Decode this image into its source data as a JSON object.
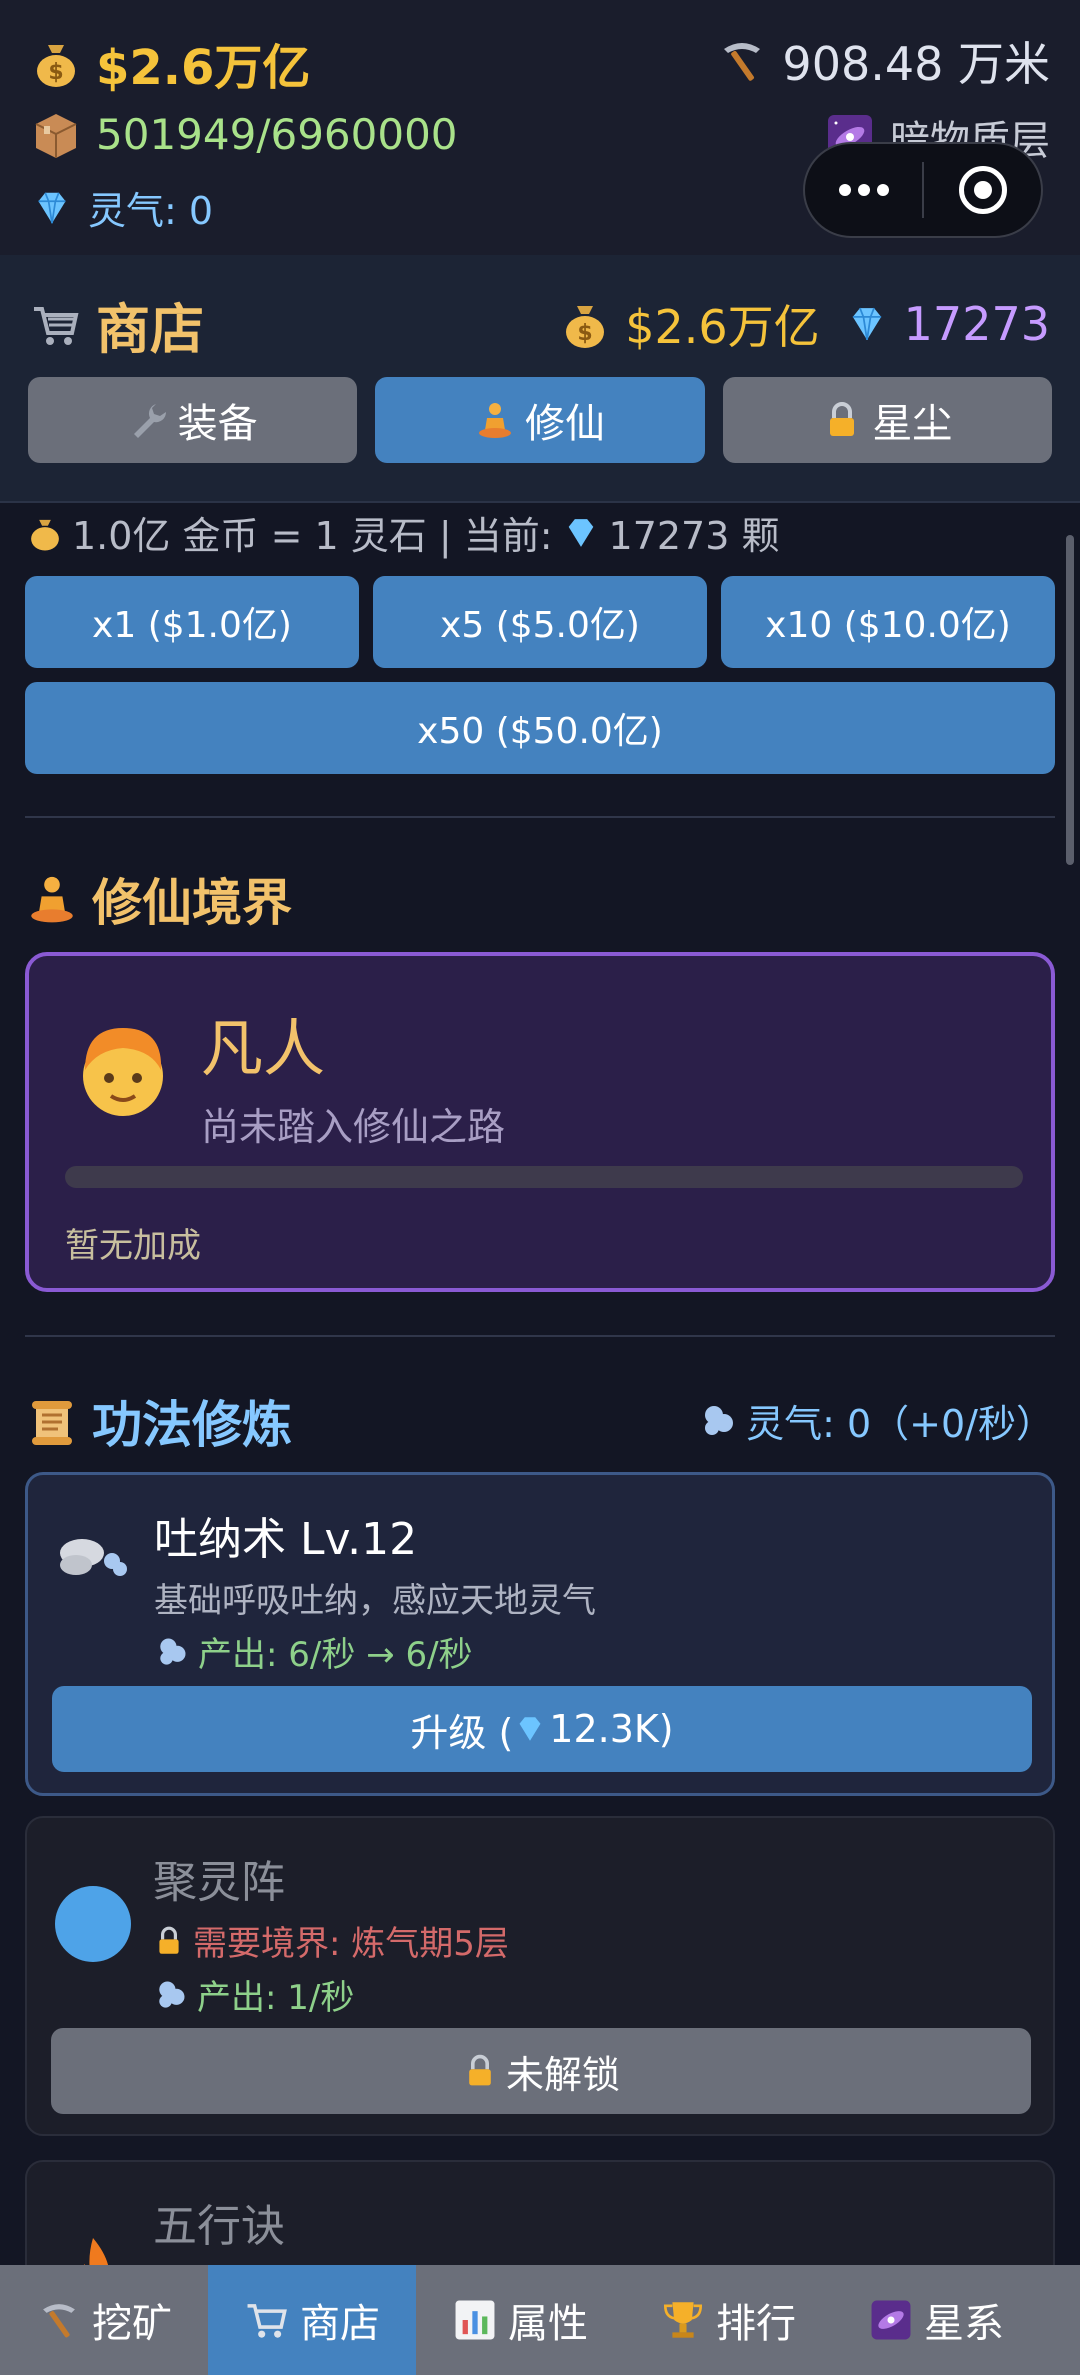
{
  "topbar": {
    "money": "$2.6万亿",
    "depth": "908.48 万米",
    "cargo": "501949/6960000",
    "layer": "暗物质层",
    "qi": "灵气: 0",
    "icons": {
      "money": "money-bag-icon",
      "depth": "pickaxe-icon",
      "cargo": "package-icon",
      "layer": "galaxy-icon",
      "qi": "diamond-icon"
    }
  },
  "shop": {
    "title": "商店",
    "money": "$2.6万亿",
    "gems": "17273",
    "tabs": [
      {
        "label": "装备",
        "icon": "wrench-icon"
      },
      {
        "label": "修仙",
        "icon": "meditation-icon"
      },
      {
        "label": "星尘",
        "icon": "lock-icon"
      }
    ],
    "active_tab": 1
  },
  "exchange": {
    "rate_text": "1.0亿 金币 = 1 灵石 | 当前:",
    "current": "17273 颗",
    "buttons": [
      "x1 ($1.0亿)",
      "x5 ($5.0亿)",
      "x10 ($10.0亿)",
      "x50 ($50.0亿)"
    ]
  },
  "realm": {
    "section_title": "修仙境界",
    "name": "凡人",
    "desc": "尚未踏入修仙之路",
    "progress": 0,
    "bonus": "暂无加成"
  },
  "skills": {
    "section_title": "功法修炼",
    "qi_info": "灵气: 0（+0/秒）",
    "items": [
      {
        "name": "吐纳术 Lv.12",
        "desc": "基础呼吸吐纳，感应天地灵气",
        "output": "产出: 6/秒 → 6/秒",
        "button": "升级 (",
        "cost": "12.3K)"
      },
      {
        "name": "聚灵阵",
        "requirement": "需要境界: 炼气期5层",
        "output": "产出: 1/秒",
        "button": "未解锁"
      },
      {
        "name": "五行诀"
      }
    ]
  },
  "nav": {
    "items": [
      {
        "label": "挖矿",
        "icon": "pickaxe-icon"
      },
      {
        "label": "商店",
        "icon": "cart-icon"
      },
      {
        "label": "属性",
        "icon": "chart-icon"
      },
      {
        "label": "排行",
        "icon": "trophy-icon"
      },
      {
        "label": "星系",
        "icon": "galaxy-icon"
      }
    ],
    "active": 1
  },
  "colors": {
    "accent": "#4482bf",
    "gold": "#f5c33b",
    "purple_border": "#8a5ad4",
    "gem": "#c69bff"
  }
}
